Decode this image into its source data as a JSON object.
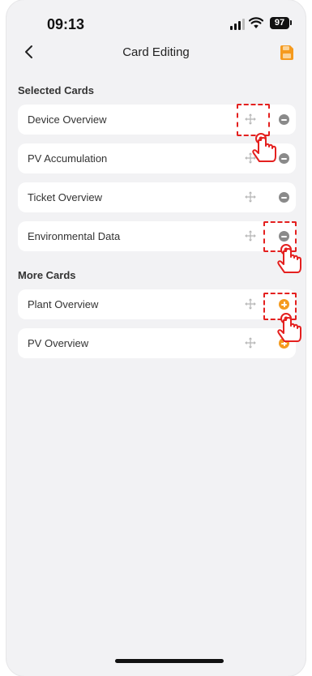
{
  "status_bar": {
    "time": "09:13",
    "battery": "97"
  },
  "nav": {
    "title": "Card Editing",
    "back_icon": "chevron-left-icon",
    "save_icon": "save-icon"
  },
  "sections": {
    "selected_title": "Selected Cards",
    "more_title": "More Cards"
  },
  "selected_cards": [
    {
      "label": "Device Overview",
      "action": "remove"
    },
    {
      "label": "PV Accumulation",
      "action": "remove"
    },
    {
      "label": "Ticket Overview",
      "action": "remove"
    },
    {
      "label": "Environmental Data",
      "action": "remove"
    }
  ],
  "more_cards": [
    {
      "label": "Plant Overview",
      "action": "add"
    },
    {
      "label": "PV Overview",
      "action": "add"
    }
  ],
  "colors": {
    "accent": "#f59a1e",
    "highlight": "#e4201f",
    "remove": "#8a8a8a"
  }
}
